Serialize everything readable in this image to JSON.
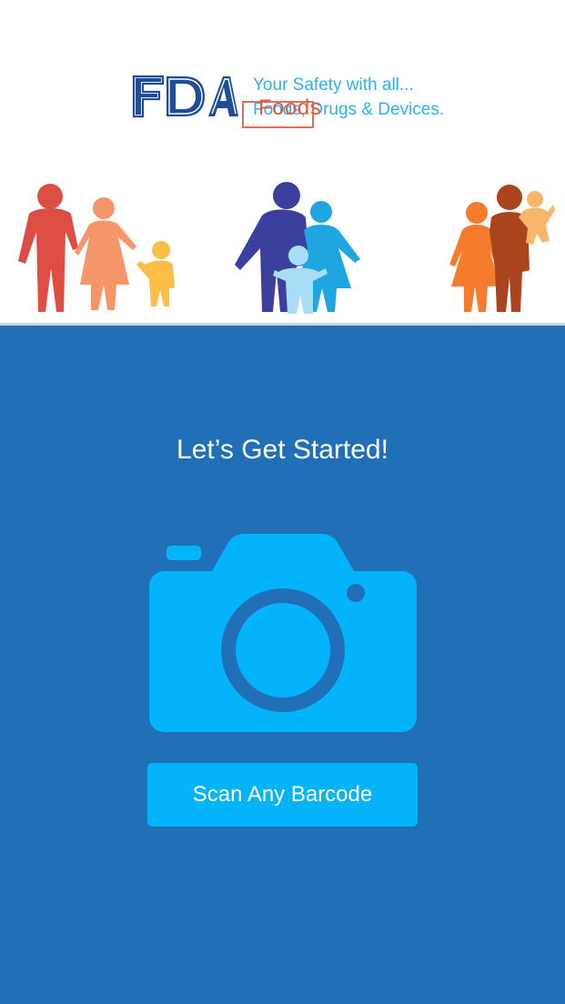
{
  "header": {
    "logo_text": "FDA",
    "tagline_line1": "Your Safety with all...",
    "tagline_line2": "Foods, Drugs & Devices.",
    "animated_word": "Foods"
  },
  "main": {
    "title": "Let’s Get Started!",
    "camera_icon": "camera-icon",
    "scan_button_label": "Scan Any Barcode"
  },
  "colors": {
    "brand_blue": "#206fb7",
    "accent_cyan": "#03b4fb",
    "logo_navy": "#1e4e9a",
    "tagline": "#2bb3ea"
  }
}
